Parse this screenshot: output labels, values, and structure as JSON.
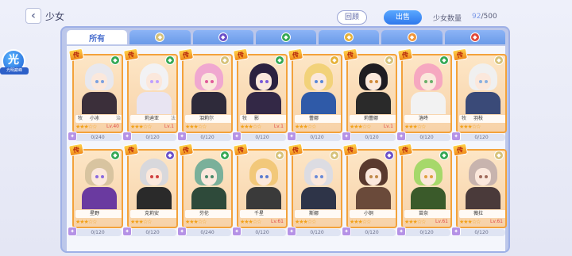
{
  "header": {
    "back_icon": "chevron-left-icon",
    "title": "少女",
    "btn_review": "回顾",
    "btn_sell": "出售",
    "count_label": "少女数量",
    "count_current": "92",
    "count_max": "/500"
  },
  "side_button": {
    "glyph": "光",
    "label": "光明巅峰"
  },
  "tabs": [
    {
      "label": "所有",
      "icon": null,
      "color": null
    },
    {
      "label": "",
      "icon": "wind-element-icon",
      "color": "#d6c27a"
    },
    {
      "label": "",
      "icon": "dark-element-icon",
      "color": "#6a4fc8"
    },
    {
      "label": "",
      "icon": "leaf-element-icon",
      "color": "#34a854"
    },
    {
      "label": "",
      "icon": "light-element-icon",
      "color": "#e6b23a"
    },
    {
      "label": "",
      "icon": "sun-element-icon",
      "color": "#f0963a"
    },
    {
      "label": "",
      "icon": "fire-element-icon",
      "color": "#e0483a"
    }
  ],
  "cards": [
    {
      "name": "小冰",
      "job": "牧",
      "cls": "治",
      "stars": "★★★☆☆",
      "lv": "Lv.40",
      "progress": "0/240",
      "legend": "传",
      "element_color": "#34a854",
      "hair": "#e8e8ee",
      "eye": "#7aa0e0",
      "outfit": "#3b2f3a"
    },
    {
      "name": "莉迪亚",
      "job": "",
      "cls": "法",
      "stars": "★★★☆☆",
      "lv": "Lv.1",
      "progress": "0/120",
      "legend": "传",
      "element_color": "#34a854",
      "hair": "#f2f2f4",
      "eye": "#c0a0ff",
      "outfit": "#e8e4f2"
    },
    {
      "name": "泪莉尔",
      "job": "",
      "cls": "",
      "stars": "★★★☆☆",
      "lv": "",
      "progress": "0/120",
      "legend": "传",
      "element_color": "#d6c27a",
      "hair": "#f0a8d0",
      "eye": "#e05a9a",
      "outfit": "#2e2a3a"
    },
    {
      "name": "影",
      "job": "牧",
      "cls": "",
      "stars": "★★★☆☆",
      "lv": "Lv.1",
      "progress": "0/120",
      "legend": "传",
      "element_color": "#34a854",
      "hair": "#2b2140",
      "eye": "#7a5ad8",
      "outfit": "#332846"
    },
    {
      "name": "蕾娜",
      "job": "",
      "cls": "",
      "stars": "★★★☆☆",
      "lv": "",
      "progress": "0/120",
      "legend": "传",
      "element_color": "#e6b23a",
      "hair": "#f2d27a",
      "eye": "#5a88d8",
      "outfit": "#2f5aa8"
    },
    {
      "name": "莉蕾娜",
      "job": "",
      "cls": "",
      "stars": "★★★☆☆",
      "lv": "Lv.1",
      "progress": "0/120",
      "legend": "传",
      "element_color": "#d6c27a",
      "hair": "#1f1c22",
      "eye": "#d08a3a",
      "outfit": "#2a2a2a"
    },
    {
      "name": "洛咚",
      "job": "",
      "cls": "",
      "stars": "★★★☆☆",
      "lv": "",
      "progress": "0/120",
      "legend": "传",
      "element_color": "#34a854",
      "hair": "#f6a8c0",
      "eye": "#6ab06a",
      "outfit": "#f2f2f2"
    },
    {
      "name": "羽枝",
      "job": "牧",
      "cls": "",
      "stars": "★★★☆☆",
      "lv": "",
      "progress": "0/120",
      "legend": "传",
      "element_color": "#d6c27a",
      "hair": "#f0f0f0",
      "eye": "#8ab0e0",
      "outfit": "#3a4a78"
    },
    {
      "name": "星野",
      "job": "",
      "cls": "",
      "stars": "★★★☆☆",
      "lv": "",
      "progress": "0/120",
      "legend": "传",
      "element_color": "#34a854",
      "hair": "#d8c4a0",
      "eye": "#8a6ae0",
      "outfit": "#6a3aa0"
    },
    {
      "name": "克莉安",
      "job": "",
      "cls": "",
      "stars": "★★★☆☆",
      "lv": "",
      "progress": "0/120",
      "legend": "传",
      "element_color": "#6a4fc8",
      "hair": "#d8d8dc",
      "eye": "#d04040",
      "outfit": "#2a2a2a"
    },
    {
      "name": "芬伦",
      "job": "",
      "cls": "",
      "stars": "★★★☆☆",
      "lv": "",
      "progress": "0/240",
      "legend": "传",
      "element_color": "#34a854",
      "hair": "#7ab09a",
      "eye": "#4a8a6a",
      "outfit": "#2e4a3a"
    },
    {
      "name": "千星",
      "job": "",
      "cls": "",
      "stars": "★★★☆☆",
      "lv": "Lv.61",
      "progress": "0/120",
      "legend": "传",
      "element_color": "#d6c27a",
      "hair": "#f2c87a",
      "eye": "#5a7ad0",
      "outfit": "#3a3a3a"
    },
    {
      "name": "斯娜",
      "job": "",
      "cls": "",
      "stars": "★★★☆☆",
      "lv": "",
      "progress": "0/120",
      "legend": "传",
      "element_color": "#d6c27a",
      "hair": "#dcdce2",
      "eye": "#6a8ad8",
      "outfit": "#2e3448"
    },
    {
      "name": "小铜",
      "job": "",
      "cls": "",
      "stars": "★★★☆☆",
      "lv": "",
      "progress": "0/120",
      "legend": "传",
      "element_color": "#6a4fc8",
      "hair": "#5a3a2e",
      "eye": "#c08a4a",
      "outfit": "#6a4a3a"
    },
    {
      "name": "苗奈",
      "job": "",
      "cls": "",
      "stars": "★★★☆☆",
      "lv": "Lv.61",
      "progress": "0/120",
      "legend": "传",
      "element_color": "#34a854",
      "hair": "#a6d86a",
      "eye": "#e0a040",
      "outfit": "#3a5a2a"
    },
    {
      "name": "薇拉",
      "job": "",
      "cls": "",
      "stars": "★★★☆☆",
      "lv": "Lv.61",
      "progress": "0/120",
      "legend": "传",
      "element_color": "#d6c27a",
      "hair": "#c8b4ae",
      "eye": "#a06a5a",
      "outfit": "#4a3a3a"
    }
  ]
}
